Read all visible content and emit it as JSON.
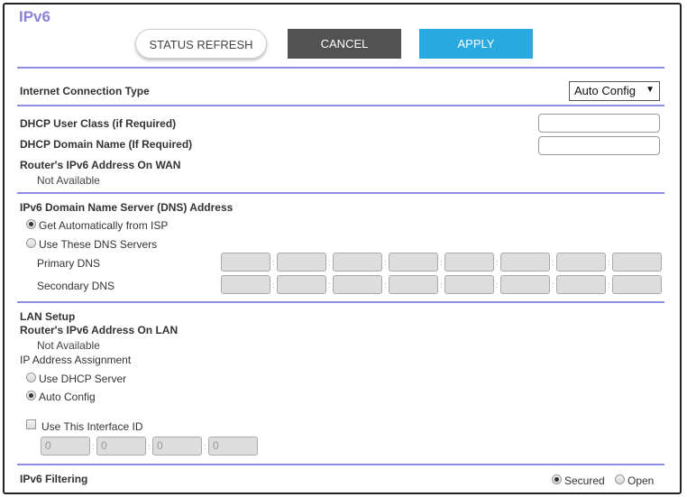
{
  "page": {
    "title": "IPv6"
  },
  "toolbar": {
    "refresh_label": "STATUS REFRESH",
    "cancel_label": "CANCEL",
    "apply_label": "APPLY"
  },
  "connection": {
    "label": "Internet Connection Type",
    "selected": "Auto Config"
  },
  "dhcp": {
    "user_class_label": "DHCP User Class (if Required)",
    "domain_name_label": "DHCP Domain Name  (If Required)",
    "user_class_value": "",
    "domain_name_value": ""
  },
  "wan": {
    "label": "Router's IPv6 Address On WAN",
    "value": "Not Available"
  },
  "dns": {
    "heading": "IPv6 Domain Name Server (DNS) Address",
    "option_auto": "Get Automatically from ISP",
    "option_manual": "Use These DNS Servers",
    "selected": "auto",
    "primary_label": "Primary DNS",
    "secondary_label": "Secondary DNS",
    "primary_values": [
      "",
      "",
      "",
      "",
      "",
      "",
      "",
      ""
    ],
    "secondary_values": [
      "",
      "",
      "",
      "",
      "",
      "",
      "",
      ""
    ]
  },
  "lan": {
    "heading": "LAN Setup",
    "address_label": "Router's IPv6 Address On LAN",
    "address_value": "Not Available",
    "assignment_label": "IP Address Assignment",
    "option_dhcp": "Use DHCP Server",
    "option_auto": "Auto Config",
    "selected": "auto",
    "interface_id_label": "Use This Interface ID",
    "interface_id_checked": false,
    "interface_id_values": [
      "0",
      "0",
      "0",
      "0"
    ]
  },
  "filtering": {
    "label": "IPv6 Filtering",
    "option_secured": "Secured",
    "option_open": "Open",
    "selected": "secured"
  },
  "colors": {
    "accent": "#8f8ee3",
    "apply": "#28aae1",
    "cancel": "#525252",
    "title": "#8b84d6"
  }
}
